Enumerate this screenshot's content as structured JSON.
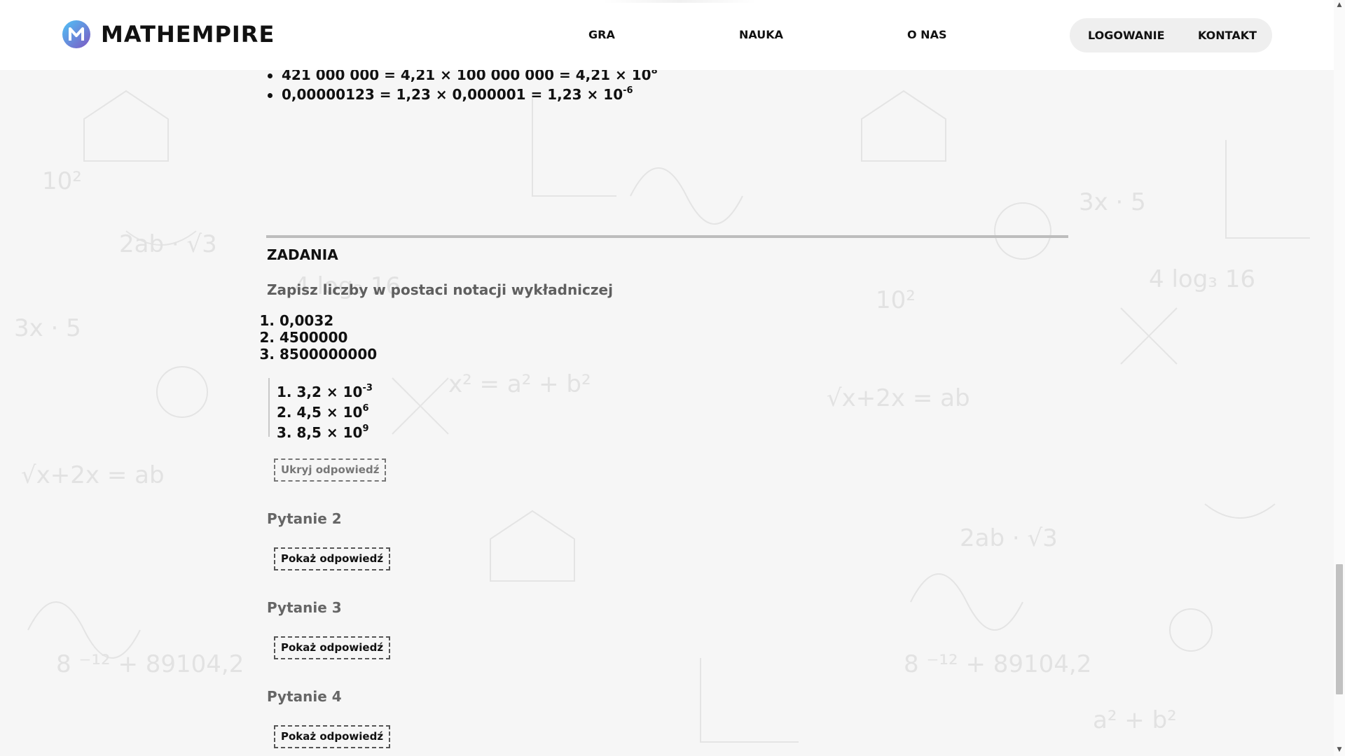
{
  "header": {
    "brand": "MATHEMPIRE",
    "nav": [
      {
        "label": "GRA"
      },
      {
        "label": "NAUKA"
      },
      {
        "label": "O NAS"
      }
    ],
    "auth": {
      "login_label": "LOGOWANIE",
      "contact_label": "KONTAKT"
    },
    "logo_icon": "m-logo-icon",
    "logo_colors": [
      "#4fc3f7",
      "#7e57c2"
    ]
  },
  "examples": [
    {
      "text": "421 000 000 = 4,21 × 100 000 000 = 4,21 × 10",
      "exp": "8"
    },
    {
      "text": "0,00000123 = 1,23 × 0,000001 = 1,23 × 10",
      "exp": "-6"
    }
  ],
  "section": {
    "title": "ZADANIA",
    "prompt": "Zapisz liczby w postaci notacji wykładniczej",
    "tasks": [
      "0,0032",
      "4500000",
      "8500000000"
    ],
    "answers": [
      {
        "num": "1.",
        "base": "3,2 × 10",
        "exp": "-3"
      },
      {
        "num": "2.",
        "base": "4,5 × 10",
        "exp": "6"
      },
      {
        "num": "3.",
        "base": "8,5 × 10",
        "exp": "9"
      }
    ],
    "hide_answer_label": "Ukryj odpowiedź"
  },
  "questions": [
    {
      "title": "Pytanie 2",
      "button_label": "Pokaż odpowiedź"
    },
    {
      "title": "Pytanie 3",
      "button_label": "Pokaż odpowiedź"
    },
    {
      "title": "Pytanie 4",
      "button_label": "Pokaż odpowiedź"
    }
  ],
  "colors": {
    "background": "#f6f6f6",
    "text": "#111111",
    "muted_text": "#5f5f5f",
    "divider": "#bdbdbd"
  }
}
